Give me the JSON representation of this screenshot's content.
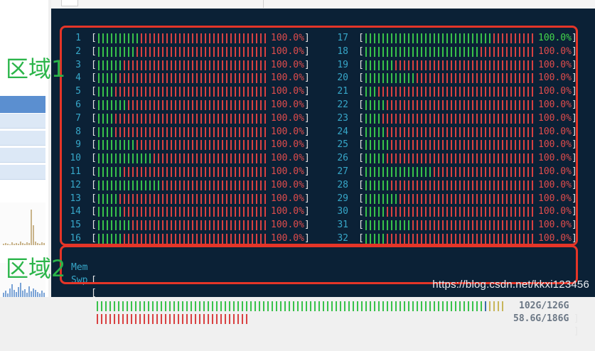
{
  "cpu_bars": [
    {
      "id": "1",
      "green": 10,
      "pct": "100.0%"
    },
    {
      "id": "2",
      "green": 9,
      "pct": "100.0%"
    },
    {
      "id": "3",
      "green": 6,
      "pct": "100.0%"
    },
    {
      "id": "4",
      "green": 5,
      "pct": "100.0%"
    },
    {
      "id": "5",
      "green": 4,
      "pct": "100.0%"
    },
    {
      "id": "6",
      "green": 7,
      "pct": "100.0%"
    },
    {
      "id": "7",
      "green": 4,
      "pct": "100.0%"
    },
    {
      "id": "8",
      "green": 4,
      "pct": "100.0%"
    },
    {
      "id": "9",
      "green": 9,
      "pct": "100.0%"
    },
    {
      "id": "10",
      "green": 13,
      "pct": "100.0%"
    },
    {
      "id": "11",
      "green": 6,
      "pct": "100.0%"
    },
    {
      "id": "12",
      "green": 15,
      "pct": "100.0%"
    },
    {
      "id": "13",
      "green": 5,
      "pct": "100.0%"
    },
    {
      "id": "14",
      "green": 6,
      "pct": "100.0%"
    },
    {
      "id": "15",
      "green": 8,
      "pct": "100.0%"
    },
    {
      "id": "16",
      "green": 6,
      "pct": "100.0%"
    },
    {
      "id": "17",
      "green": 30,
      "pct": "100.0%"
    },
    {
      "id": "18",
      "green": 27,
      "pct": "100.0%"
    },
    {
      "id": "19",
      "green": 7,
      "pct": "100.0%"
    },
    {
      "id": "20",
      "green": 12,
      "pct": "100.0%"
    },
    {
      "id": "21",
      "green": 3,
      "pct": "100.0%"
    },
    {
      "id": "22",
      "green": 5,
      "pct": "100.0%"
    },
    {
      "id": "23",
      "green": 4,
      "pct": "100.0%"
    },
    {
      "id": "24",
      "green": 5,
      "pct": "100.0%"
    },
    {
      "id": "25",
      "green": 6,
      "pct": "100.0%"
    },
    {
      "id": "26",
      "green": 5,
      "pct": "100.0%"
    },
    {
      "id": "27",
      "green": 16,
      "pct": "100.0%"
    },
    {
      "id": "28",
      "green": 6,
      "pct": "100.0%"
    },
    {
      "id": "29",
      "green": 8,
      "pct": "100.0%"
    },
    {
      "id": "30",
      "green": 5,
      "pct": "100.0%"
    },
    {
      "id": "31",
      "green": 11,
      "pct": "100.0%"
    },
    {
      "id": "32",
      "green": 5,
      "pct": "100.0%"
    }
  ],
  "mem": {
    "label": "Mem",
    "value": "102G/126G"
  },
  "swp": {
    "label": "Swp",
    "value": "58.6G/186G"
  },
  "open_bracket": "[",
  "close_bracket": "]",
  "region1_label": "区域1",
  "region2_label": "区域2",
  "watermark": "https://blog.csdn.net/kkxi123456",
  "colors": {
    "green": "#38c24a",
    "red": "#d94141",
    "cyan": "#37a7c9",
    "bg": "#0b2136",
    "annotation": "#e53528"
  }
}
